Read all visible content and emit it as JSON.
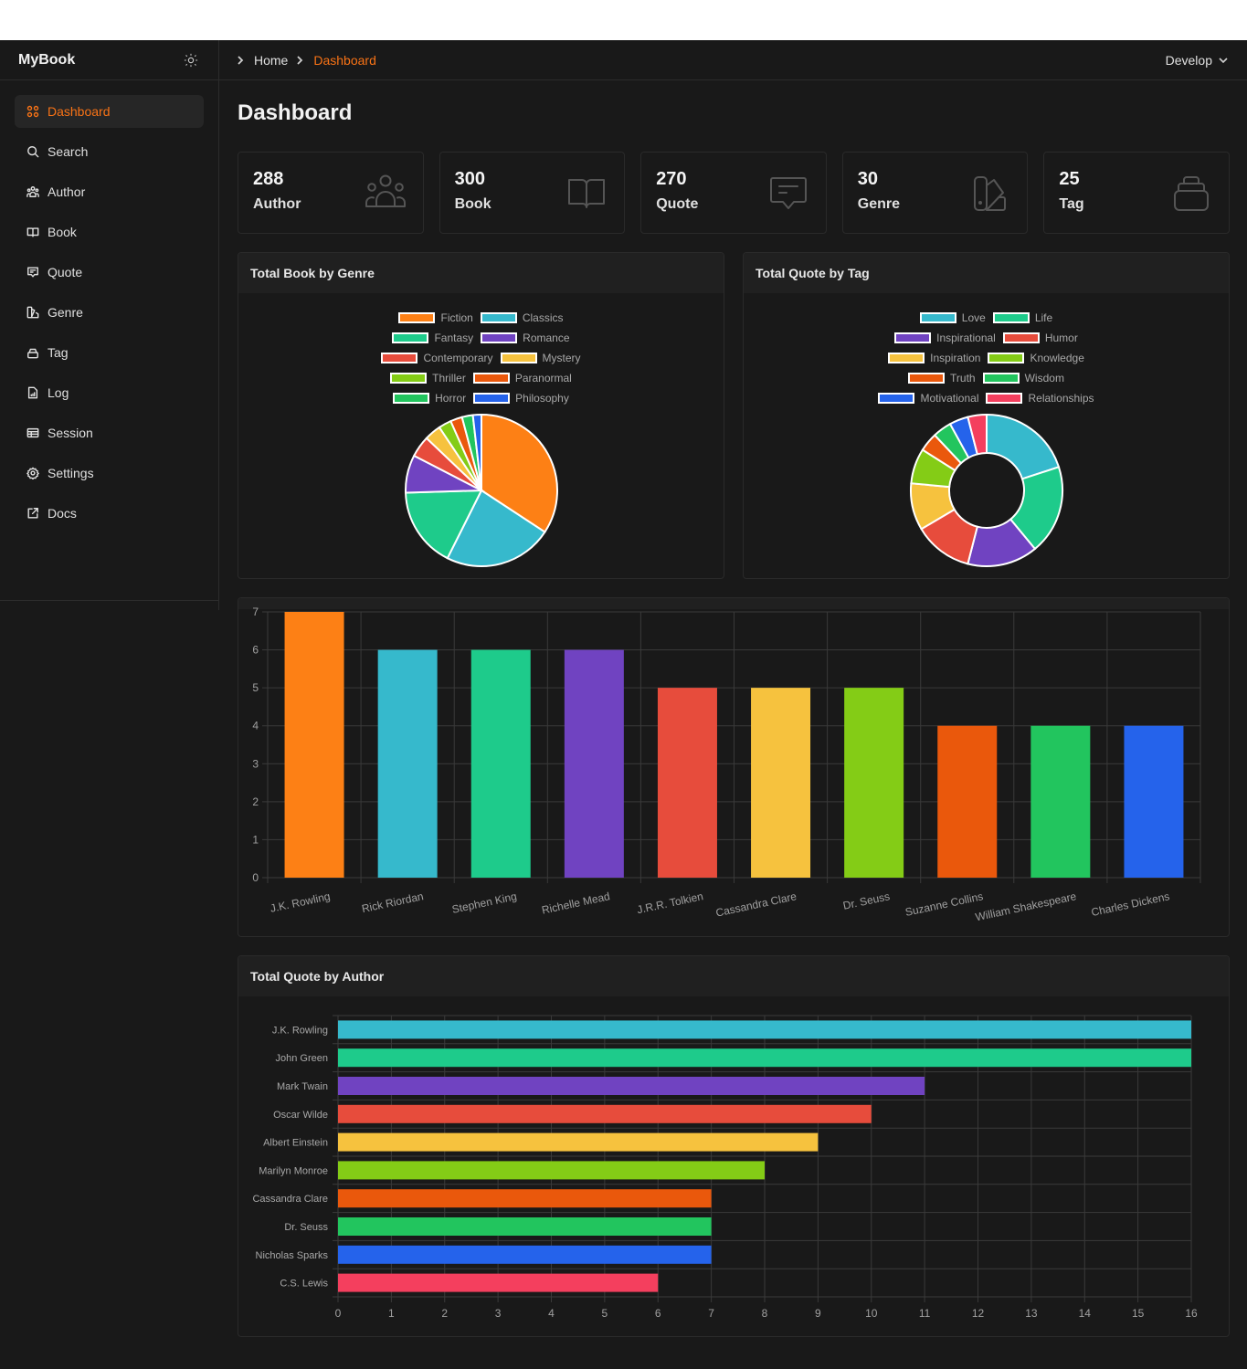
{
  "app": {
    "brand": "MyBook",
    "theme_toggle_icon": "sun-icon"
  },
  "sidebar": {
    "items": [
      {
        "label": "Dashboard",
        "icon": "grid-icon",
        "active": true
      },
      {
        "label": "Search",
        "icon": "search-icon"
      },
      {
        "label": "Author",
        "icon": "users-icon"
      },
      {
        "label": "Book",
        "icon": "book-open-icon"
      },
      {
        "label": "Quote",
        "icon": "message-icon"
      },
      {
        "label": "Genre",
        "icon": "swatch-icon"
      },
      {
        "label": "Tag",
        "icon": "stack-icon"
      },
      {
        "label": "Log",
        "icon": "file-chart-icon"
      },
      {
        "label": "Session",
        "icon": "table-icon"
      },
      {
        "label": "Settings",
        "icon": "gear-icon"
      },
      {
        "label": "Docs",
        "icon": "external-link-icon"
      }
    ]
  },
  "topbar": {
    "breadcrumb": [
      "Home",
      "Dashboard"
    ],
    "environment": "Develop"
  },
  "page": {
    "title": "Dashboard"
  },
  "stats": [
    {
      "value": "288",
      "label": "Author",
      "icon": "users-icon"
    },
    {
      "value": "300",
      "label": "Book",
      "icon": "book-open-icon"
    },
    {
      "value": "270",
      "label": "Quote",
      "icon": "message-icon"
    },
    {
      "value": "30",
      "label": "Genre",
      "icon": "swatch-icon"
    },
    {
      "value": "25",
      "label": "Tag",
      "icon": "stack-icon"
    }
  ],
  "colors": {
    "accent": "#f97316",
    "background": "#191919",
    "card_header": "#202020",
    "grid": "#3a3a3a",
    "palette": [
      "#fd8015",
      "#36b9cc",
      "#1ecb8b",
      "#7043c1",
      "#e74c3c",
      "#f6c23e",
      "#84cc16",
      "#ea580c",
      "#22c55e",
      "#2563eb",
      "#f43f5e"
    ]
  },
  "chart_data": [
    {
      "type": "pie",
      "title": "Total Book by Genre",
      "legend": "top",
      "categories": [
        "Fiction",
        "Classics",
        "Fantasy",
        "Romance",
        "Contemporary",
        "Mystery",
        "Thriller",
        "Paranormal",
        "Horror",
        "Philosophy"
      ],
      "values": [
        34,
        23,
        17,
        8,
        4.5,
        3.5,
        2.7,
        2.5,
        2.3,
        1.8
      ],
      "colors": [
        "#fd8015",
        "#36b9cc",
        "#1ecb8b",
        "#7043c1",
        "#e74c3c",
        "#f6c23e",
        "#84cc16",
        "#ea580c",
        "#22c55e",
        "#2563eb"
      ]
    },
    {
      "type": "pie",
      "subtype": "doughnut",
      "title": "Total Quote by Tag",
      "legend": "top",
      "categories": [
        "Love",
        "Life",
        "Inspirational",
        "Humor",
        "Inspiration",
        "Knowledge",
        "Truth",
        "Wisdom",
        "Motivational",
        "Relationships"
      ],
      "values": [
        20,
        19,
        15,
        12.5,
        10,
        7.5,
        4,
        4,
        4,
        4
      ],
      "colors": [
        "#36b9cc",
        "#1ecb8b",
        "#7043c1",
        "#e74c3c",
        "#f6c23e",
        "#84cc16",
        "#ea580c",
        "#22c55e",
        "#2563eb",
        "#f43f5e"
      ]
    },
    {
      "type": "bar",
      "title": "",
      "categories": [
        "J.K. Rowling",
        "Rick Riordan",
        "Stephen King",
        "Richelle Mead",
        "J.R.R. Tolkien",
        "Cassandra Clare",
        "Dr. Seuss",
        "Suzanne Collins",
        "William Shakespeare",
        "Charles Dickens"
      ],
      "values": [
        7,
        6,
        6,
        6,
        5,
        5,
        5,
        4,
        4,
        4
      ],
      "colors": [
        "#fd8015",
        "#36b9cc",
        "#1ecb8b",
        "#7043c1",
        "#e74c3c",
        "#f6c23e",
        "#84cc16",
        "#ea580c",
        "#22c55e",
        "#2563eb"
      ],
      "xlabel": "",
      "ylabel": "",
      "ylim": [
        0,
        7
      ],
      "yticks": [
        0,
        1,
        2,
        3,
        4,
        5,
        6,
        7
      ],
      "grid": true
    },
    {
      "type": "bar",
      "orientation": "horizontal",
      "title": "Total Quote by Author",
      "categories": [
        "J.K. Rowling",
        "John Green",
        "Mark Twain",
        "Oscar Wilde",
        "Albert Einstein",
        "Marilyn Monroe",
        "Cassandra Clare",
        "Dr. Seuss",
        "Nicholas Sparks",
        "C.S. Lewis"
      ],
      "values": [
        16,
        16,
        11,
        10,
        9,
        8,
        7,
        7,
        7,
        6
      ],
      "colors": [
        "#36b9cc",
        "#1ecb8b",
        "#7043c1",
        "#e74c3c",
        "#f6c23e",
        "#84cc16",
        "#ea580c",
        "#22c55e",
        "#2563eb",
        "#f43f5e"
      ],
      "xlabel": "",
      "ylabel": "",
      "xlim": [
        0,
        16
      ],
      "xticks": [
        0,
        1,
        2,
        3,
        4,
        5,
        6,
        7,
        8,
        9,
        10,
        11,
        12,
        13,
        14,
        15,
        16
      ],
      "grid": true
    }
  ]
}
